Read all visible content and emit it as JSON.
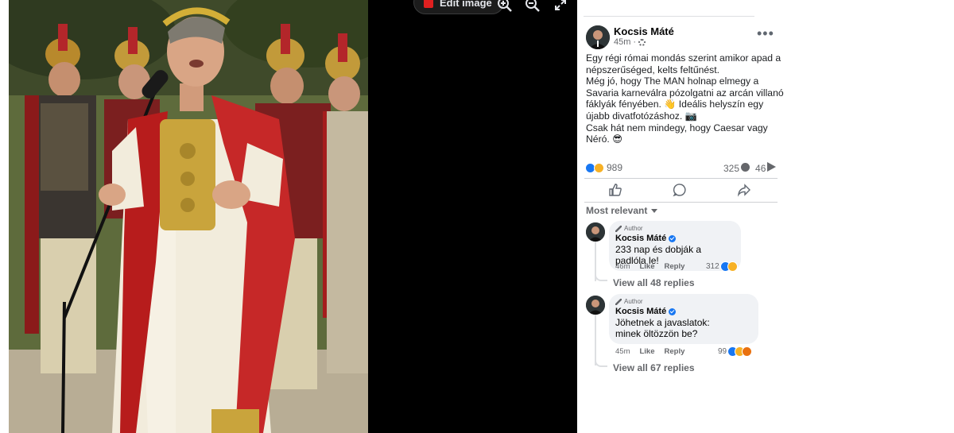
{
  "viewer": {
    "edit_image_label": "Edit image",
    "icons": [
      "pdf-icon",
      "zoom-in-icon",
      "zoom-out-icon",
      "expand-icon"
    ]
  },
  "post": {
    "author": "Kocsis Máté",
    "time": "45m",
    "text_lines": [
      "Egy régi római mondás szerint amikor apad a népszerűséged, kelts feltűnést.",
      "Még jó, hogy The MAN holnap elmegy a Savaria karneválra pózolgatni az arcán villanó fáklyák fényében. 👋 Ideális helyszín egy újabb divatfotózáshoz. 📷",
      "Csak hát nem mindegy, hogy Caesar vagy Néró. 😎"
    ],
    "reaction_count": "989",
    "comment_count": "325",
    "share_count": "46"
  },
  "sort_label": "Most relevant",
  "comments": [
    {
      "author_tag": "Author",
      "name": "Kocsis Máté",
      "text": "233 nap és dobják a padlóla le!",
      "time": "46m",
      "like_label": "Like",
      "reply_label": "Reply",
      "reaction_count": "312",
      "view_replies": "View all 48 replies"
    },
    {
      "author_tag": "Author",
      "name": "Kocsis Máté",
      "text": "Jöhetnek a javaslatok: minek öltözzön be?",
      "time": "45m",
      "like_label": "Like",
      "reply_label": "Reply",
      "reaction_count": "99",
      "view_replies": "View all 67 replies"
    }
  ],
  "colors": {
    "accent": "#1877f2",
    "viewer_bg": "#000000",
    "bubble_bg": "#f0f2f5",
    "toga_red": "#c62828"
  }
}
